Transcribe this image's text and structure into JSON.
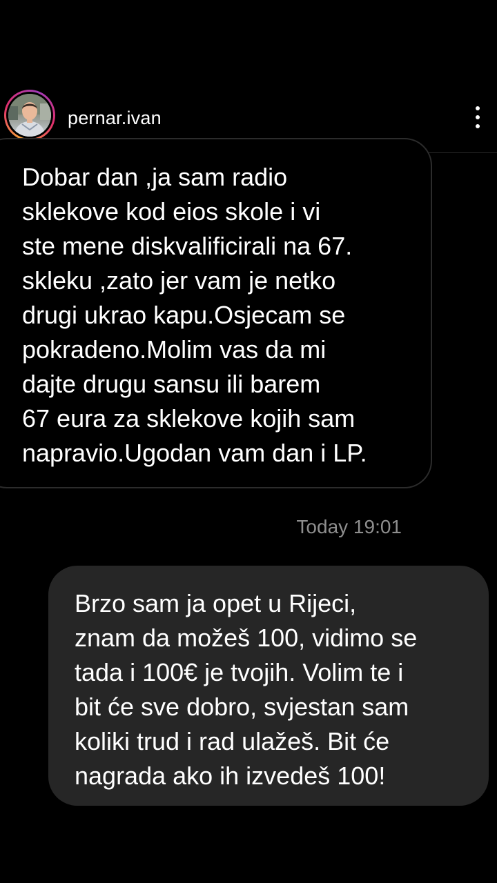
{
  "header": {
    "username": "pernar.ivan",
    "avatar_icon": "profile-photo"
  },
  "messages": [
    {
      "direction": "incoming",
      "text": "Dobar dan ,ja sam radio\nsklekove kod eios skole i vi\nste mene diskvalificirali na 67.\nskleku ,zato jer vam je netko\ndrugi ukrao kapu.Osjecam se\npokradeno.Molim vas da mi\ndajte drugu sansu ili barem\n67 eura za sklekove kojih sam\nnapravio.Ugodan vam dan i LP."
    },
    {
      "direction": "separator",
      "text": "Today 19:01"
    },
    {
      "direction": "outgoing",
      "text": "Brzo sam ja opet u Rijeci,\nznam da možeš 100, vidimo se\ntada i 100€ je tvojih. Volim te i\nbit će sve dobro, svjestan sam\nkoliki trud i rad ulažeš. Bit će\nnagrada ako ih izvedeš 100!"
    }
  ],
  "colors": {
    "background": "#000000",
    "outgoing_bubble": "#262626",
    "incoming_border": "#2c2c2c",
    "timestamp": "#8e8e8e",
    "story_ring": [
      "#f9a33a",
      "#e1306c",
      "#a13bb8"
    ]
  }
}
